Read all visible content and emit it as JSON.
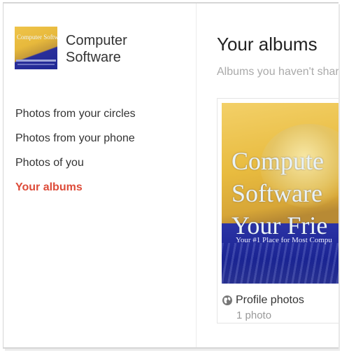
{
  "profile": {
    "name": "Computer Software",
    "thumbnail_text": "Computer Software is Your Friend"
  },
  "nav": {
    "items": [
      {
        "label": "Photos from your circles"
      },
      {
        "label": "Photos from your phone"
      },
      {
        "label": "Photos of you"
      },
      {
        "label": "Your albums",
        "active": true
      }
    ]
  },
  "main": {
    "title": "Your albums",
    "subtitle": "Albums you haven't shar"
  },
  "album": {
    "cover_text": "Compute\nSoftware\nYour Frie",
    "cover_tagline": "Your #1 Place for Most Compu",
    "title": "Profile photos",
    "count": "1 photo",
    "visibility_icon": "globe-icon"
  },
  "colors": {
    "accent": "#dd4b39",
    "text": "#333333",
    "muted": "#999999"
  }
}
